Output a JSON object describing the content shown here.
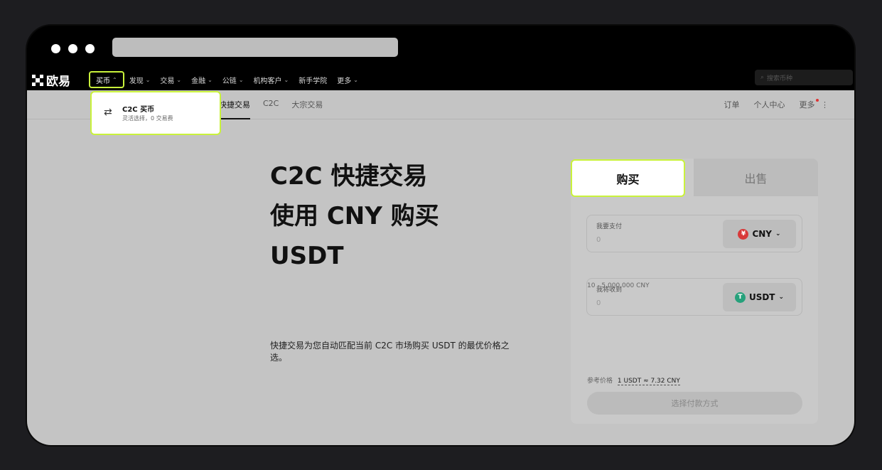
{
  "nav": {
    "logo_text": "欧易",
    "items": [
      {
        "label": "买币",
        "active": true
      },
      {
        "label": "发现"
      },
      {
        "label": "交易"
      },
      {
        "label": "金融"
      },
      {
        "label": "公链"
      },
      {
        "label": "机构客户"
      },
      {
        "label": "新手学院"
      },
      {
        "label": "更多"
      }
    ],
    "search_placeholder": "搜索币种"
  },
  "dropdown": {
    "title": "C2C 买币",
    "desc": "灵活选择，0 交易费"
  },
  "subnav": {
    "left": [
      "快捷交易",
      "C2C",
      "大宗交易"
    ],
    "right": [
      "订单",
      "个人中心",
      "更多"
    ]
  },
  "hero": {
    "line1": "C2C 快捷交易",
    "line2": "使用 CNY 购买",
    "line3": "USDT",
    "desc": "快捷交易为您自动匹配当前 C2C 市场购买 USDT 的最优价格之选。"
  },
  "panel": {
    "tab_buy": "购买",
    "tab_sell": "出售",
    "pay": {
      "label": "我要支付",
      "value": "0",
      "currency": "CNY",
      "coin_color": "#d83a3a",
      "coin_glyph": "¥"
    },
    "range": "10 - 5,000,000 CNY",
    "receive": {
      "label": "我将收到",
      "value": "0",
      "currency": "USDT",
      "coin_color": "#26a17b",
      "coin_glyph": "T"
    },
    "ref_label": "参考价格",
    "ref_value": "1 USDT ≈ 7.32 CNY",
    "button": "选择付款方式"
  },
  "colors": {
    "highlight": "#c9f23b"
  }
}
